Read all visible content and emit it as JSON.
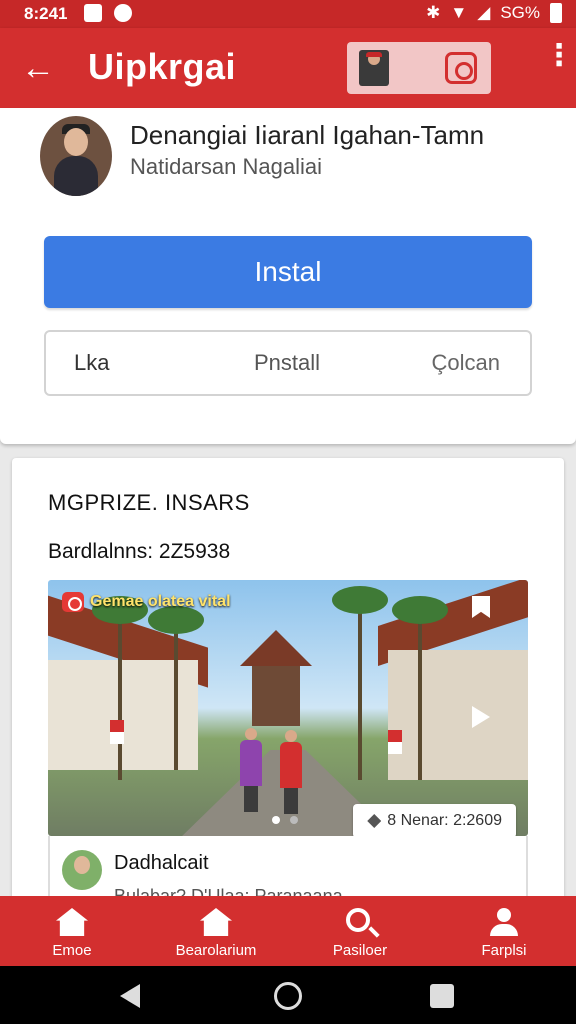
{
  "status_bar": {
    "time": "8:241",
    "battery": "SG%"
  },
  "app_bar": {
    "title": "Uipkrgai"
  },
  "app": {
    "name": "Denangiai Iiaranl Igahan-Tamn",
    "developer": "Natidarsan Nagaliai",
    "install_label": "Instal",
    "actions": [
      "Lka",
      "Pnstall",
      "Çolcan"
    ]
  },
  "details": {
    "section_title": "MGPRIZE. INSARS",
    "downloads": "Bardlalnns: 2Z5938",
    "banner": {
      "label": "Gemae olatea vital",
      "views": "8 Nenar: 2:2609"
    },
    "review": {
      "name": "Dadhalcait",
      "snippet": "Bulabar? D'Ulaa: Paranaana"
    }
  },
  "bottom_nav": [
    {
      "label": "Emoe",
      "icon": "home-icon"
    },
    {
      "label": "Bearolarium",
      "icon": "home-icon"
    },
    {
      "label": "Pasiloer",
      "icon": "search-icon"
    },
    {
      "label": "Farplsi",
      "icon": "person-icon"
    }
  ],
  "colors": {
    "primary": "#d32f2f",
    "install": "#3b7be3"
  }
}
